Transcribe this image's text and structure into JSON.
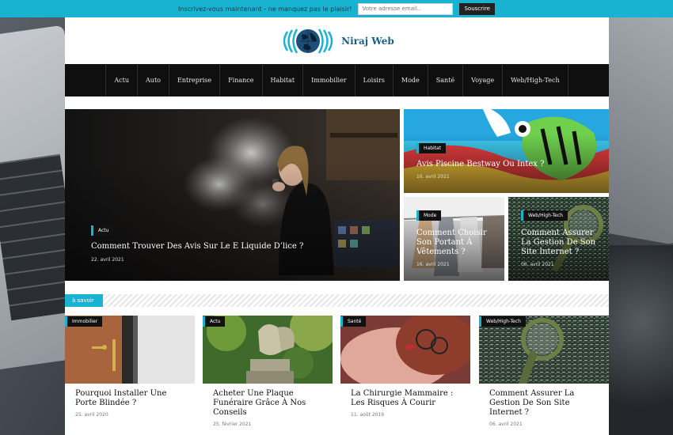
{
  "topbar": {
    "text": "Inscrivez-vous maintenant - ne manquez pas le plaisir!",
    "email_placeholder": "Votre adresse email..",
    "subscribe_label": "Souscrire"
  },
  "brand": {
    "name": "Niraj Web"
  },
  "nav": [
    "Actu",
    "Auto",
    "Entreprise",
    "Finance",
    "Habitat",
    "Immobilier",
    "Loisirs",
    "Mode",
    "Santé",
    "Voyage",
    "Web/High-Tech"
  ],
  "featured": {
    "main": {
      "category": "Actu",
      "title": "Comment Trouver Des Avis Sur Le E Liquide D’lice ?",
      "date": "22. avril 2021"
    },
    "top_right": {
      "category": "Habitat",
      "title": "Avis Piscine Bestway Ou Intex ?",
      "date": "16. avril 2021"
    },
    "mid_left": {
      "category": "Mode",
      "title": "Comment Choisir Son Portant À Vêtements ?",
      "date": "16. avril 2021"
    },
    "mid_right": {
      "category": "Web/High-Tech",
      "title": "Comment Assurer La Gestion De Son Site Internet ?",
      "date": "06. avril 2021"
    }
  },
  "section": {
    "label": "à savoir"
  },
  "cards": [
    {
      "category": "Immobilier",
      "title": "Pourquoi Installer Une Porte Blindée ?",
      "date": "25. avril 2020"
    },
    {
      "category": "Actu",
      "title": "Acheter Une Plaque Funéraire Grâce À Nos Conseils",
      "date": "25. février 2021"
    },
    {
      "category": "Santé",
      "title": "La Chirurgie Mammaire : Les Risques À Courir",
      "date": "11. août 2019"
    },
    {
      "category": "Web/High-Tech",
      "title": "Comment Assurer La Gestion De Son Site Internet ?",
      "date": "06. avril 2021"
    }
  ],
  "colors": {
    "accent": "#17b3d1",
    "nav_bg": "#0f0f0f",
    "brand": "#1c5f85"
  }
}
